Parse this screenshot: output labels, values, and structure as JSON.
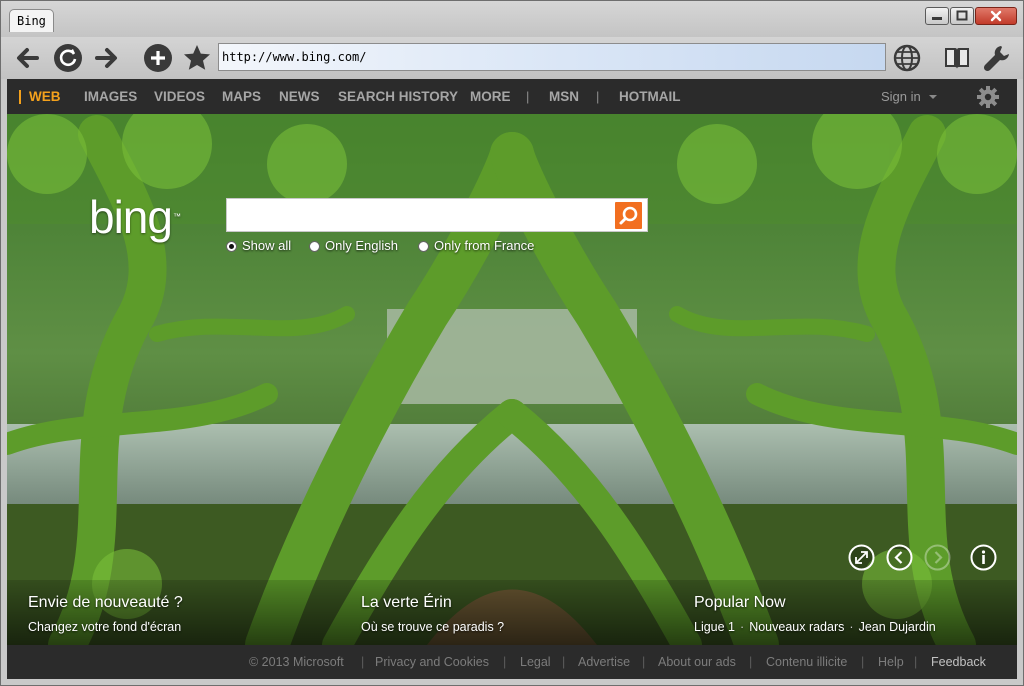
{
  "window": {
    "tab_title": "Bing"
  },
  "toolbar": {
    "url": "http://www.bing.com/"
  },
  "nav": {
    "items": [
      "WEB",
      "IMAGES",
      "VIDEOS",
      "MAPS",
      "NEWS",
      "SEARCH HISTORY",
      "MORE",
      "MSN",
      "HOTMAIL"
    ],
    "separator": "|",
    "signin": "Sign in"
  },
  "search": {
    "logo": "bing",
    "trademark": "™",
    "query": "",
    "options": [
      "Show all",
      "Only English",
      "Only from France"
    ],
    "selected_option": "Show all"
  },
  "tiles": [
    {
      "title": "Envie de nouveauté ?",
      "subtitle": "Changez votre fond d'écran"
    },
    {
      "title": "La verte Érin",
      "subtitle": "Où se trouve ce paradis ?"
    },
    {
      "title": "Popular Now",
      "links": [
        "Ligue 1",
        "Nouveaux radars",
        "Jean Dujardin"
      ],
      "link_separator": "·"
    }
  ],
  "footer": {
    "items": [
      "© 2013 Microsoft",
      "Privacy and Cookies",
      "Legal",
      "Advertise",
      "About our ads",
      "Contenu illicite",
      "Help",
      "Feedback"
    ],
    "separator": "|"
  },
  "colors": {
    "accent": "#f4a11c",
    "search_button": "#f26f20",
    "bar_bg": "#2b2b2b"
  },
  "icons": {
    "toolbar": [
      "back-icon",
      "reload-icon",
      "forward-icon",
      "add-icon",
      "bookmark-star-icon",
      "globe-icon",
      "book-icon",
      "wrench-icon"
    ],
    "hero_controls": [
      "fullscreen-icon",
      "previous-icon",
      "next-icon",
      "info-icon"
    ]
  }
}
